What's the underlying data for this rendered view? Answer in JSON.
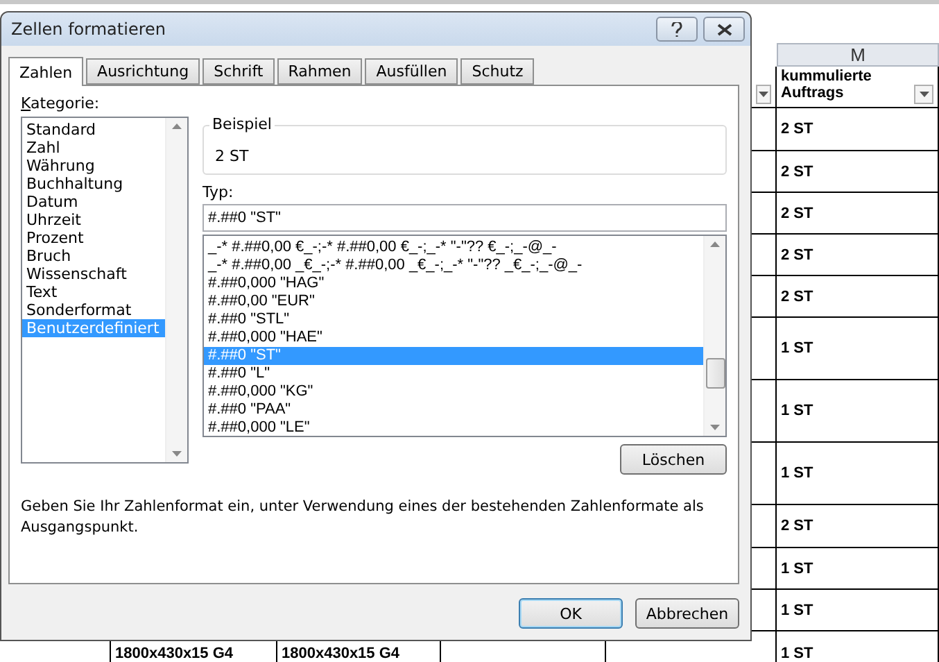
{
  "sheet": {
    "column_letter": "M",
    "filter_header": "kummulierte Auftrags",
    "m_values": [
      "2 ST",
      "2 ST",
      "2 ST",
      "2 ST",
      "2 ST",
      "1 ST",
      "1 ST",
      "1 ST",
      "2 ST",
      "1 ST",
      "1 ST",
      "1 ST"
    ],
    "last_row_cells": [
      "1800x430x15 G4",
      "1800x430x15 G4"
    ]
  },
  "dialog": {
    "title": "Zellen formatieren",
    "tabs": [
      {
        "label": "Zahlen",
        "selected": true
      },
      {
        "label": "Ausrichtung",
        "selected": false
      },
      {
        "label": "Schrift",
        "selected": false
      },
      {
        "label": "Rahmen",
        "selected": false
      },
      {
        "label": "Ausfüllen",
        "selected": false
      },
      {
        "label": "Schutz",
        "selected": false
      }
    ],
    "category_label": "Kategorie:",
    "categories": [
      {
        "label": "Standard",
        "selected": false
      },
      {
        "label": "Zahl",
        "selected": false
      },
      {
        "label": "Währung",
        "selected": false
      },
      {
        "label": "Buchhaltung",
        "selected": false
      },
      {
        "label": "Datum",
        "selected": false
      },
      {
        "label": "Uhrzeit",
        "selected": false
      },
      {
        "label": "Prozent",
        "selected": false
      },
      {
        "label": "Bruch",
        "selected": false
      },
      {
        "label": "Wissenschaft",
        "selected": false
      },
      {
        "label": "Text",
        "selected": false
      },
      {
        "label": "Sonderformat",
        "selected": false
      },
      {
        "label": "Benutzerdefiniert",
        "selected": true
      }
    ],
    "sample": {
      "label": "Beispiel",
      "value": "2 ST"
    },
    "type_label": "Typ:",
    "type_value": "#.##0 \"ST\"",
    "formats": [
      {
        "label": "_-* #.##0,00 €_-;-* #.##0,00 €_-;_-* \"-\"?? €_-;_-@_-",
        "selected": false
      },
      {
        "label": "_-* #.##0,00 _€_-;-* #.##0,00 _€_-;_-* \"-\"?? _€_-;_-@_-",
        "selected": false
      },
      {
        "label": "#.##0,000 \"HAG\"",
        "selected": false
      },
      {
        "label": "#.##0,00 \"EUR\"",
        "selected": false
      },
      {
        "label": "#.##0 \"STL\"",
        "selected": false
      },
      {
        "label": "#.##0,000 \"HAE\"",
        "selected": false
      },
      {
        "label": "#.##0 \"ST\"",
        "selected": true
      },
      {
        "label": "#.##0 \"L\"",
        "selected": false
      },
      {
        "label": "#.##0,000 \"KG\"",
        "selected": false
      },
      {
        "label": "#.##0 \"PAA\"",
        "selected": false
      },
      {
        "label": "#.##0,000 \"LE\"",
        "selected": false
      }
    ],
    "delete_button": "Löschen",
    "description": "Geben Sie Ihr Zahlenformat ein, unter Verwendung eines der bestehenden Zahlenformate als Ausgangspunkt.",
    "buttons": [
      {
        "label": "OK",
        "kind": "default"
      },
      {
        "label": "Abbrechen",
        "kind": "normal"
      }
    ]
  }
}
